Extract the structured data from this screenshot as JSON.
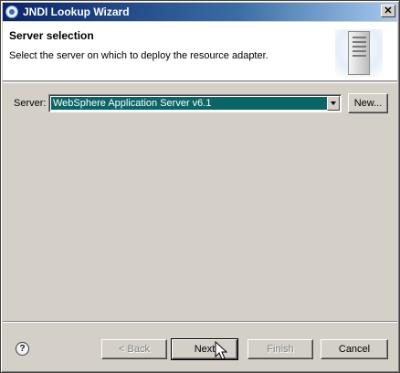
{
  "window": {
    "title": "JNDI Lookup Wizard",
    "close_label": "✕"
  },
  "banner": {
    "title": "Server selection",
    "description": "Select the server on which to deploy the resource adapter."
  },
  "server": {
    "label": "Server:",
    "selected_value": "WebSphere Application Server v6.1",
    "new_button": "New..."
  },
  "footer": {
    "help_label": "?",
    "back_button": "< Back",
    "next_button": "Next",
    "finish_button": "Finish",
    "cancel_button": "Cancel"
  },
  "colors": {
    "title_bar_start": "#0a246a",
    "title_bar_end": "#a6caf0",
    "selection_highlight": "#0a6666",
    "dialog_face": "#d4d0c8"
  },
  "icons": {
    "window": "wizard-app-icon",
    "banner": "server-tower-icon",
    "help": "help-icon",
    "dropdown": "chevron-down-icon"
  }
}
